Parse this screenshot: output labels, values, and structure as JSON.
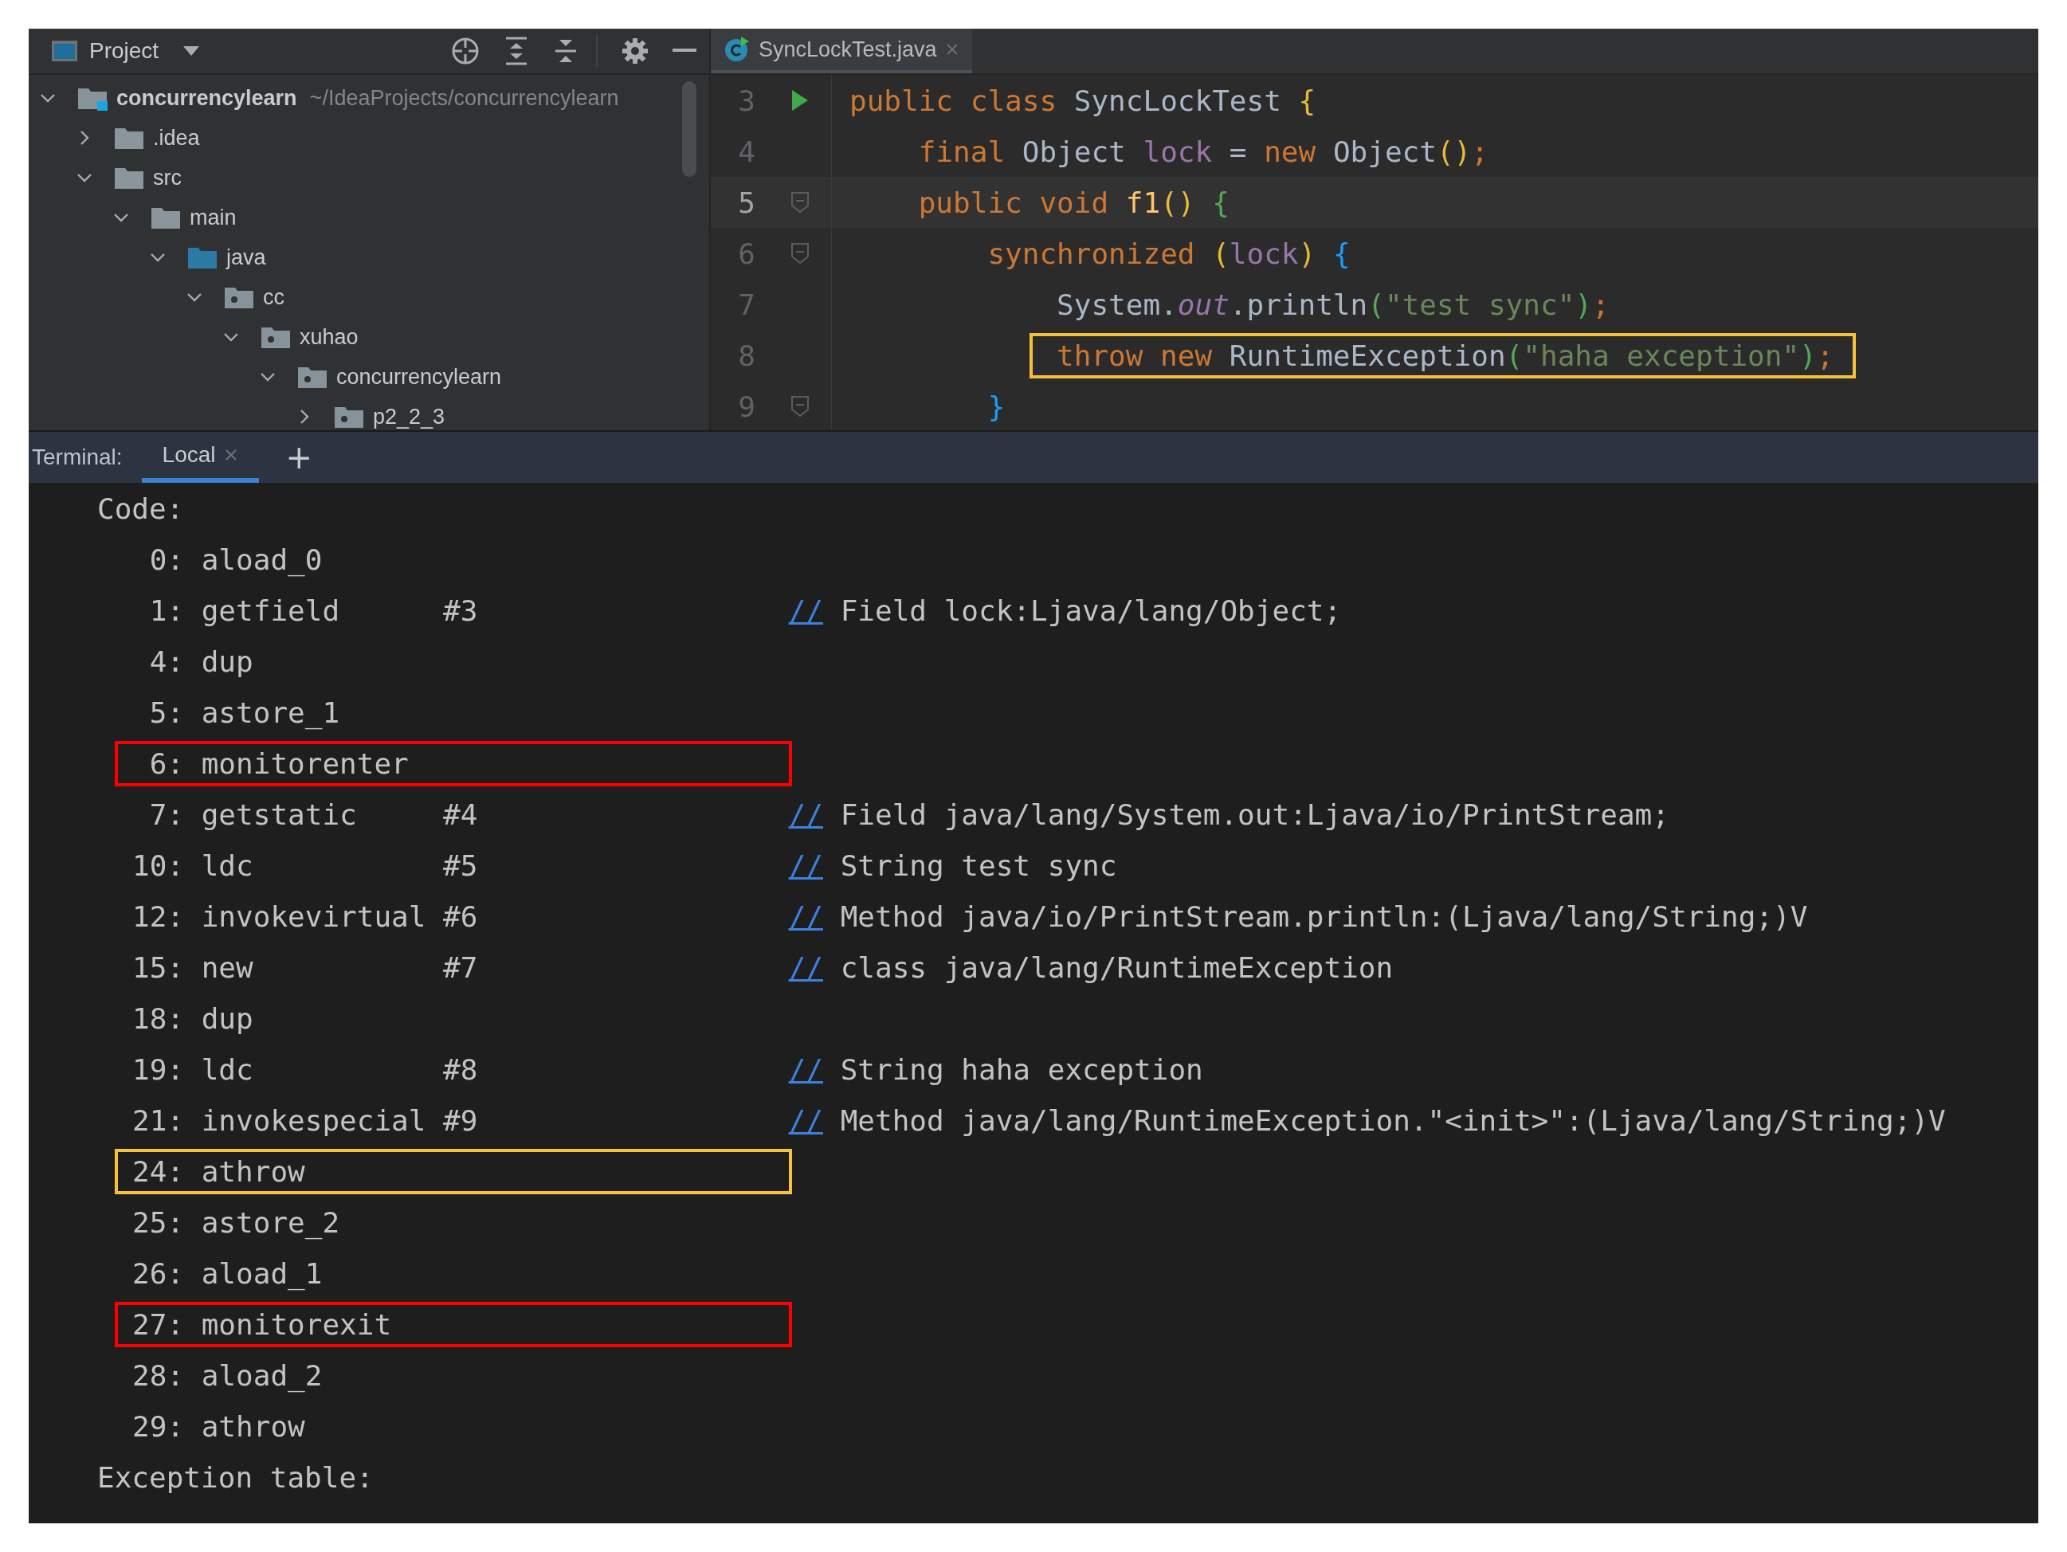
{
  "project_panel": {
    "title": "Project",
    "tree": [
      {
        "name": "concurrencylearn",
        "path": "~/IdeaProjects/concurrencylearn",
        "kind": "module",
        "expanded": true,
        "children": [
          {
            "name": ".idea",
            "kind": "folder",
            "expanded": false
          },
          {
            "name": "src",
            "kind": "folder",
            "expanded": true,
            "children": [
              {
                "name": "main",
                "kind": "folder",
                "expanded": true,
                "children": [
                  {
                    "name": "java",
                    "kind": "source",
                    "expanded": true,
                    "children": [
                      {
                        "name": "cc",
                        "kind": "package",
                        "expanded": true,
                        "children": [
                          {
                            "name": "xuhao",
                            "kind": "package",
                            "expanded": true,
                            "children": [
                              {
                                "name": "concurrencylearn",
                                "kind": "package",
                                "expanded": true,
                                "children": [
                                  {
                                    "name": "p2_2_3",
                                    "kind": "package",
                                    "expanded": false
                                  }
                                ]
                              }
                            ]
                          }
                        ]
                      }
                    ]
                  }
                ]
              }
            ]
          }
        ]
      }
    ]
  },
  "editor": {
    "tabs": [
      {
        "label": "SyncLockTest.java",
        "selected": true
      }
    ],
    "lines": [
      {
        "number": "3",
        "current": false,
        "run": true,
        "fold": false,
        "boxed": false,
        "tokens": [
          {
            "kind": "keyword",
            "text": "public class "
          },
          {
            "kind": "plain",
            "text": "SyncLockTest "
          },
          {
            "kind": "bracket",
            "text": "{",
            "color": "#e8ba36"
          }
        ]
      },
      {
        "number": "4",
        "current": false,
        "run": false,
        "fold": false,
        "boxed": false,
        "tokens": [
          {
            "kind": "keyword",
            "text": "    final "
          },
          {
            "kind": "plain",
            "text": "Object "
          },
          {
            "kind": "field",
            "text": "lock "
          },
          {
            "kind": "plain",
            "text": "= "
          },
          {
            "kind": "keyword",
            "text": "new "
          },
          {
            "kind": "plain",
            "text": "Object"
          },
          {
            "kind": "bracket",
            "text": "()",
            "color": "#e8ba36"
          },
          {
            "kind": "keyword",
            "text": ";"
          }
        ]
      },
      {
        "number": "5",
        "current": true,
        "run": false,
        "fold": true,
        "boxed": false,
        "tokens": [
          {
            "kind": "keyword",
            "text": "    public void "
          },
          {
            "kind": "method",
            "text": "f1"
          },
          {
            "kind": "bracket",
            "text": "() ",
            "color": "#e8ba36"
          },
          {
            "kind": "bracket",
            "text": "{",
            "color": "#54a857"
          }
        ]
      },
      {
        "number": "6",
        "current": false,
        "run": false,
        "fold": true,
        "boxed": false,
        "tokens": [
          {
            "kind": "keyword",
            "text": "        synchronized "
          },
          {
            "kind": "bracket",
            "text": "(",
            "color": "#e8ba36"
          },
          {
            "kind": "field",
            "text": "lock"
          },
          {
            "kind": "bracket",
            "text": ") ",
            "color": "#e8ba36"
          },
          {
            "kind": "bracket",
            "text": "{",
            "color": "#179fff"
          }
        ]
      },
      {
        "number": "7",
        "current": false,
        "run": false,
        "fold": false,
        "boxed": false,
        "tokens": [
          {
            "kind": "plain",
            "text": "            System."
          },
          {
            "kind": "static",
            "text": "out"
          },
          {
            "kind": "plain",
            "text": ".println"
          },
          {
            "kind": "bracket",
            "text": "(",
            "color": "#54a857"
          },
          {
            "kind": "string",
            "text": "\"test sync\""
          },
          {
            "kind": "bracket",
            "text": ")",
            "color": "#54a857"
          },
          {
            "kind": "keyword",
            "text": ";"
          }
        ]
      },
      {
        "number": "8",
        "current": false,
        "run": false,
        "fold": false,
        "boxed": true,
        "tokens": [
          {
            "kind": "keyword",
            "text": "            throw new "
          },
          {
            "kind": "plain",
            "text": "RuntimeException"
          },
          {
            "kind": "bracket",
            "text": "(",
            "color": "#54a857"
          },
          {
            "kind": "string",
            "text": "\"haha exception\""
          },
          {
            "kind": "bracket",
            "text": ")",
            "color": "#54a857"
          },
          {
            "kind": "keyword",
            "text": ";"
          }
        ]
      },
      {
        "number": "9",
        "current": false,
        "run": false,
        "fold": true,
        "boxed": false,
        "tokens": [
          {
            "kind": "bracket",
            "text": "        }",
            "color": "#179fff"
          }
        ]
      }
    ]
  },
  "terminal": {
    "label": "Terminal:",
    "tabs": [
      {
        "label": "Local",
        "selected": true
      }
    ],
    "add": "+",
    "lines": [
      {
        "kind": "label",
        "text": "Code:"
      },
      {
        "kind": "instruction",
        "offset": "0:",
        "opcode": "aload_0"
      },
      {
        "kind": "instruction",
        "offset": "1:",
        "opcode": "getfield",
        "operand": "#3",
        "marker": "//",
        "comment": "Field lock:Ljava/lang/Object;"
      },
      {
        "kind": "instruction",
        "offset": "4:",
        "opcode": "dup"
      },
      {
        "kind": "instruction",
        "offset": "5:",
        "opcode": "astore_1"
      },
      {
        "kind": "instruction",
        "offset": "6:",
        "opcode": "monitorenter",
        "color": "#ff0000"
      },
      {
        "kind": "instruction",
        "offset": "7:",
        "opcode": "getstatic",
        "operand": "#4",
        "marker": "//",
        "comment": "Field java/lang/System.out:Ljava/io/PrintStream;"
      },
      {
        "kind": "instruction",
        "offset": "10:",
        "opcode": "ldc",
        "operand": "#5",
        "marker": "//",
        "comment": "String test sync"
      },
      {
        "kind": "instruction",
        "offset": "12:",
        "opcode": "invokevirtual",
        "operand": "#6",
        "marker": "//",
        "comment": "Method java/io/PrintStream.println:(Ljava/lang/String;)V"
      },
      {
        "kind": "instruction",
        "offset": "15:",
        "opcode": "new",
        "operand": "#7",
        "marker": "//",
        "comment": "class java/lang/RuntimeException"
      },
      {
        "kind": "instruction",
        "offset": "18:",
        "opcode": "dup"
      },
      {
        "kind": "instruction",
        "offset": "19:",
        "opcode": "ldc",
        "operand": "#8",
        "marker": "//",
        "comment": "String haha exception"
      },
      {
        "kind": "instruction",
        "offset": "21:",
        "opcode": "invokespecial",
        "operand": "#9",
        "marker": "//",
        "comment": "Method java/lang/RuntimeException.\"<init>\":(Ljava/lang/String;)V"
      },
      {
        "kind": "instruction",
        "offset": "24:",
        "opcode": "athrow",
        "color": "#f7c23b"
      },
      {
        "kind": "instruction",
        "offset": "25:",
        "opcode": "astore_2"
      },
      {
        "kind": "instruction",
        "offset": "26:",
        "opcode": "aload_1"
      },
      {
        "kind": "instruction",
        "offset": "27:",
        "opcode": "monitorexit",
        "color": "#ff0000"
      },
      {
        "kind": "instruction",
        "offset": "28:",
        "opcode": "aload_2"
      },
      {
        "kind": "instruction",
        "offset": "29:",
        "opcode": "athrow"
      },
      {
        "kind": "label",
        "text": "Exception table:"
      }
    ]
  }
}
